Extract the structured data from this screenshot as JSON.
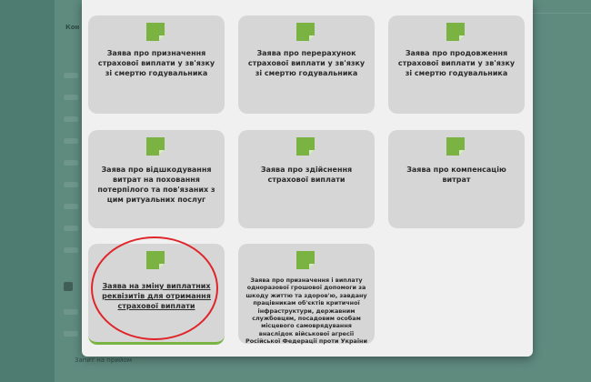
{
  "background": {
    "section_label_partial": "Кон",
    "bottom_item_label": "Запит на прийом"
  },
  "cards": [
    {
      "title": "Заява про призначення страхової виплати у зв'язку зі смертю годувальника"
    },
    {
      "title": "Заява про перерахунок страхової виплати у зв'язку зі смертю годувальника"
    },
    {
      "title": "Заява про продовження страхової виплати у зв'язку зі смертю годувальника"
    },
    {
      "title": "Заява про відшкодування витрат на поховання потерпілого та пов'язаних з цим ритуальних послуг"
    },
    {
      "title": "Заява про здійснення страхової виплати"
    },
    {
      "title": "Заява про компенсацію витрат"
    },
    {
      "title": "Заява на зміну виплатних реквізитів для отримання страхової виплати"
    },
    {
      "title": "Заява про призначення і виплату одноразової грошової допомоги за шкоду життю та здоров'ю, завдану працівникам об'єктів критичної інфраструктури, державним службовцям, посадовим особам місцевого самоврядування внаслідок військової агресії Російської Федерації проти України"
    }
  ],
  "colors": {
    "accent": "#7bb342",
    "annotation": "#e0252a",
    "overlay": "#4f7c70"
  }
}
